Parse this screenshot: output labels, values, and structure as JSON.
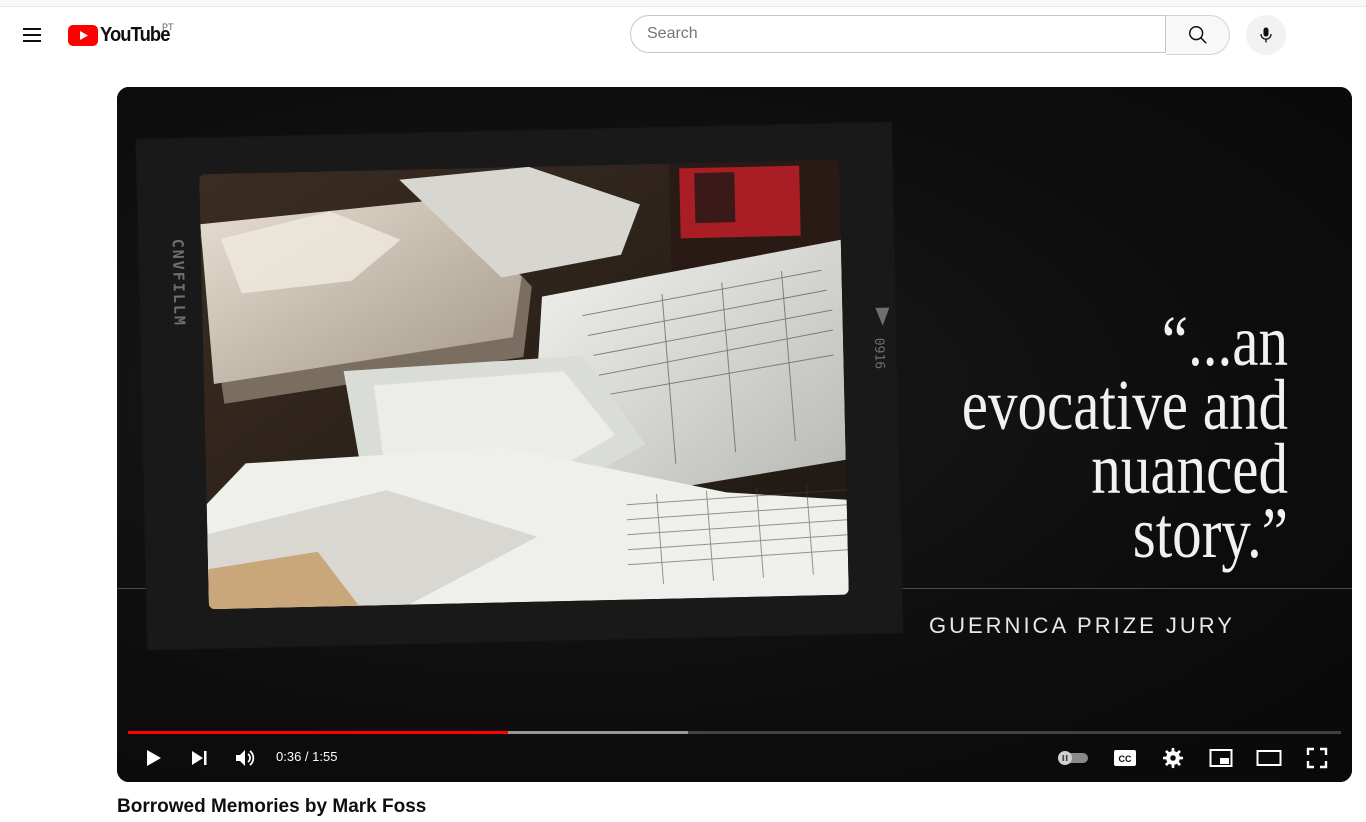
{
  "header": {
    "logo_text": "YouTube",
    "country_code": "PT",
    "search_placeholder": "Search"
  },
  "player": {
    "overlay_quote": "“...an evocative and nuanced story.”",
    "overlay_quote_lines": [
      "“...an",
      "evocative and",
      "nuanced",
      "story.”"
    ],
    "overlay_attribution": "GUERNICA PRIZE JURY",
    "film_edge_text": "CNVFILLM",
    "film_frame_number": "0916",
    "current_time": "0:36",
    "duration": "1:55",
    "time_display": "0:36 / 1:55",
    "played_fraction": 0.313,
    "buffered_fraction": 0.462,
    "autoplay_enabled": false,
    "accent_color": "#ff0000"
  },
  "video": {
    "title": "Borrowed Memories by Mark Foss"
  }
}
